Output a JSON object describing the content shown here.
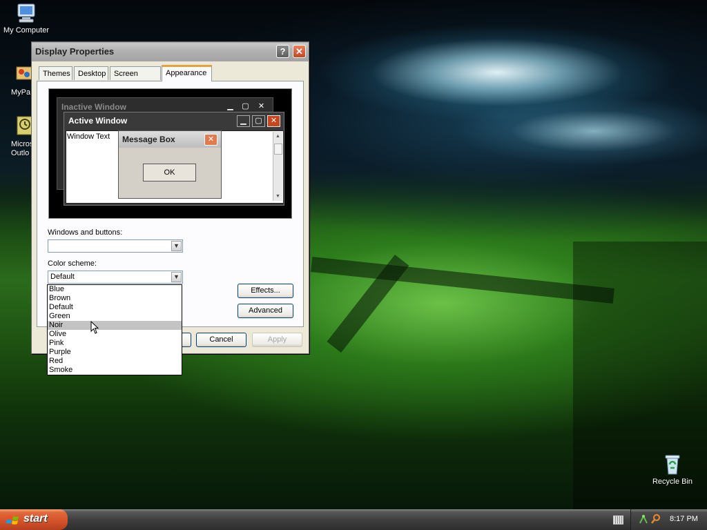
{
  "desktop": {
    "icons": [
      {
        "label": "My Computer"
      },
      {
        "label": "MyPa"
      },
      {
        "label": "Micros Outlo"
      },
      {
        "label": "Recycle Bin"
      }
    ]
  },
  "dialog": {
    "title": "Display Properties",
    "help_glyph": "?",
    "close_glyph": "✕",
    "tabs": [
      {
        "label": "Themes"
      },
      {
        "label": "Desktop"
      },
      {
        "label": "Screen Saver"
      },
      {
        "label": "Appearance"
      }
    ],
    "active_tab": "Appearance",
    "preview": {
      "inactive_title": "Inactive Window",
      "active_title": "Active Window",
      "window_text": "Window Text",
      "message_box_title": "Message Box",
      "ok_label": "OK"
    },
    "windows_buttons_label": "Windows and buttons:",
    "windows_buttons_value": "",
    "color_scheme_label": "Color scheme:",
    "color_scheme_value": "Default",
    "color_scheme_options": [
      "Blue",
      "Brown",
      "Default",
      "Green",
      "Noir",
      "Olive",
      "Pink",
      "Purple",
      "Red",
      "Smoke"
    ],
    "highlighted_option": "Noir",
    "effects_label": "Effects...",
    "advanced_label": "Advanced",
    "cancel_label": "Cancel",
    "apply_label": "Apply"
  },
  "taskbar": {
    "start_label": "start",
    "clock": "8:17 PM"
  }
}
